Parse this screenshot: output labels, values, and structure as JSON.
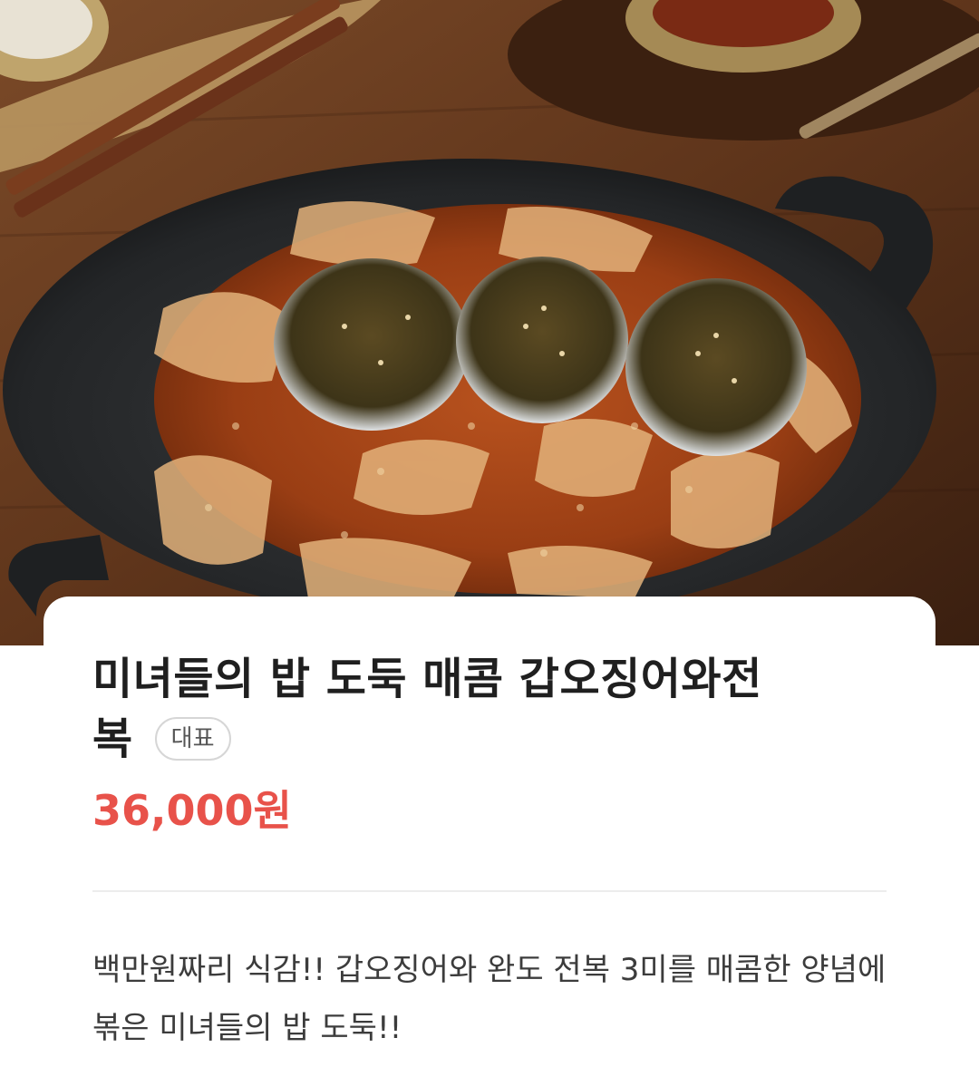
{
  "menu_item": {
    "name_line1": "미녀들의 밥 도둑 매콤 갑오징어와전",
    "name_line2": "복",
    "badge": "대표",
    "price": "36,000원",
    "description": "백만원짜리 식감!! 갑오징어와 완도 전복 3미를 매콤한 양념에 볶은 미녀들의 밥 도둑!!"
  },
  "icons": {
    "hero": "food-photo"
  },
  "colors": {
    "price": "#e8524a",
    "title": "#1f1f1f",
    "body": "#3c3c3c"
  }
}
